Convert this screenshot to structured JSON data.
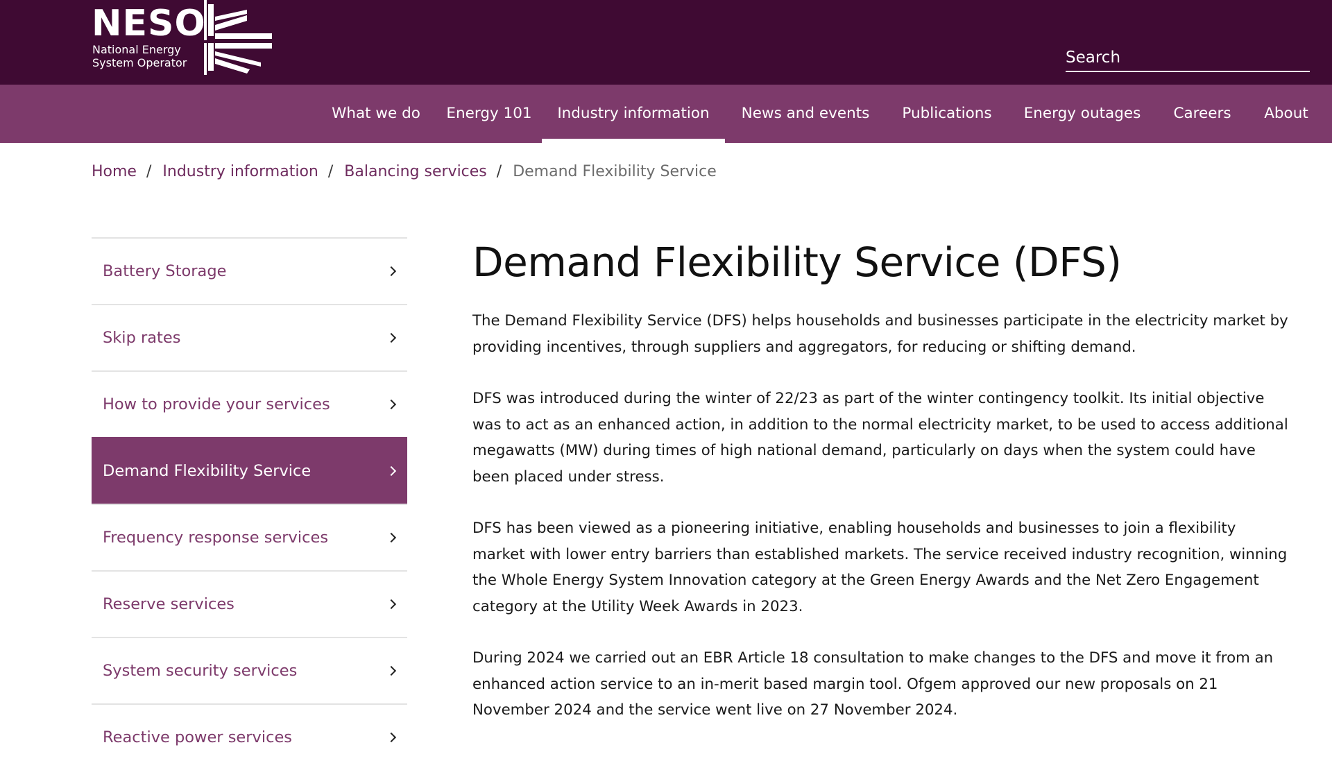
{
  "brand": {
    "name": "NESO",
    "subtitle_line1": "National Energy",
    "subtitle_line2": "System Operator",
    "primary_color": "#3f0a33",
    "nav_color": "#7d3a6b"
  },
  "search": {
    "placeholder": "Search"
  },
  "nav": {
    "items": [
      {
        "label": "What we do"
      },
      {
        "label": "Energy 101"
      },
      {
        "label": "Industry information",
        "active": true
      },
      {
        "label": "News and events"
      },
      {
        "label": "Publications"
      },
      {
        "label": "Energy outages"
      },
      {
        "label": "Careers"
      },
      {
        "label": "About"
      }
    ]
  },
  "breadcrumb": {
    "items": [
      "Home",
      "Industry information",
      "Balancing services"
    ],
    "separator": "/",
    "current": "Demand Flexibility Service"
  },
  "sidebar": {
    "items": [
      {
        "label": "Battery Storage",
        "icon": "chevron-right-icon"
      },
      {
        "label": "Skip rates",
        "icon": "chevron-right-icon"
      },
      {
        "label": "How to provide your services",
        "icon": "chevron-right-icon"
      },
      {
        "label": "Demand Flexibility Service",
        "icon": "chevron-right-icon",
        "active": true
      },
      {
        "label": "Frequency response services",
        "icon": "chevron-right-icon"
      },
      {
        "label": "Reserve services",
        "icon": "chevron-right-icon"
      },
      {
        "label": "System security services",
        "icon": "chevron-right-icon"
      },
      {
        "label": "Reactive power services",
        "icon": "chevron-right-icon"
      }
    ]
  },
  "main": {
    "title": "Demand Flexibility Service (DFS)",
    "paragraphs": [
      "The Demand Flexibility Service (DFS) helps households and businesses participate in the electricity market by providing incentives, through suppliers and aggregators, for reducing or shifting demand.",
      "DFS was introduced during the winter of 22/23 as part of the winter contingency toolkit. Its initial objective was to act as an enhanced action, in addition to the normal electricity market, to be used to access additional megawatts (MW) during times of high national demand, particularly on days when the system could have been placed under stress.",
      "DFS has been viewed as a pioneering initiative, enabling households and businesses to join a flexibility market with lower entry barriers than established markets. The service received industry recognition, winning the Whole Energy System Innovation category at the Green Energy Awards and the Net Zero Engagement category at the Utility Week Awards in 2023.",
      "During 2024 we carried out an EBR Article 18 consultation to make changes to the DFS and move it from an enhanced action service to an in-merit based margin tool. Ofgem approved our new proposals on 21 November 2024 and the service went live on 27 November 2024."
    ]
  }
}
